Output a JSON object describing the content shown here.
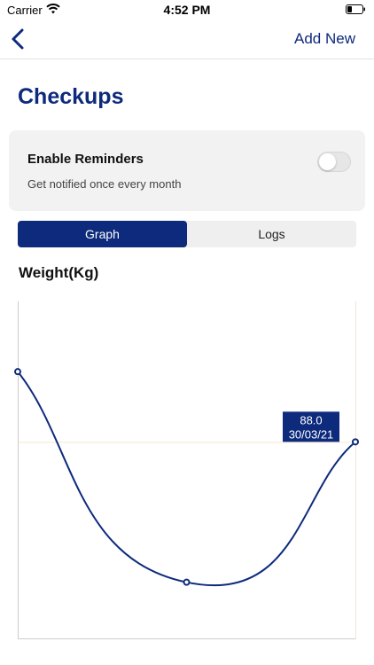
{
  "status_bar": {
    "carrier": "Carrier",
    "time": "4:52 PM"
  },
  "nav": {
    "back_icon": "chevron-left-icon",
    "add_new_label": "Add New"
  },
  "page": {
    "title": "Checkups"
  },
  "reminders": {
    "title": "Enable Reminders",
    "subtitle": "Get notified once every month",
    "enabled": false
  },
  "tabs": [
    {
      "label": "Graph",
      "selected": true
    },
    {
      "label": "Logs",
      "selected": false
    }
  ],
  "colors": {
    "accent": "#0d2a7c",
    "card_bg": "#f2f2f2",
    "grid_line": "#f3e6cf"
  },
  "chart_data": {
    "type": "line",
    "title": "Weight(Kg)",
    "series": [
      {
        "values": [
          98.0,
          68.0,
          88.0
        ]
      }
    ],
    "ylim": [
      60,
      108
    ],
    "tooltip": {
      "value_label": "88.0",
      "date_label": "30/03/21"
    }
  }
}
